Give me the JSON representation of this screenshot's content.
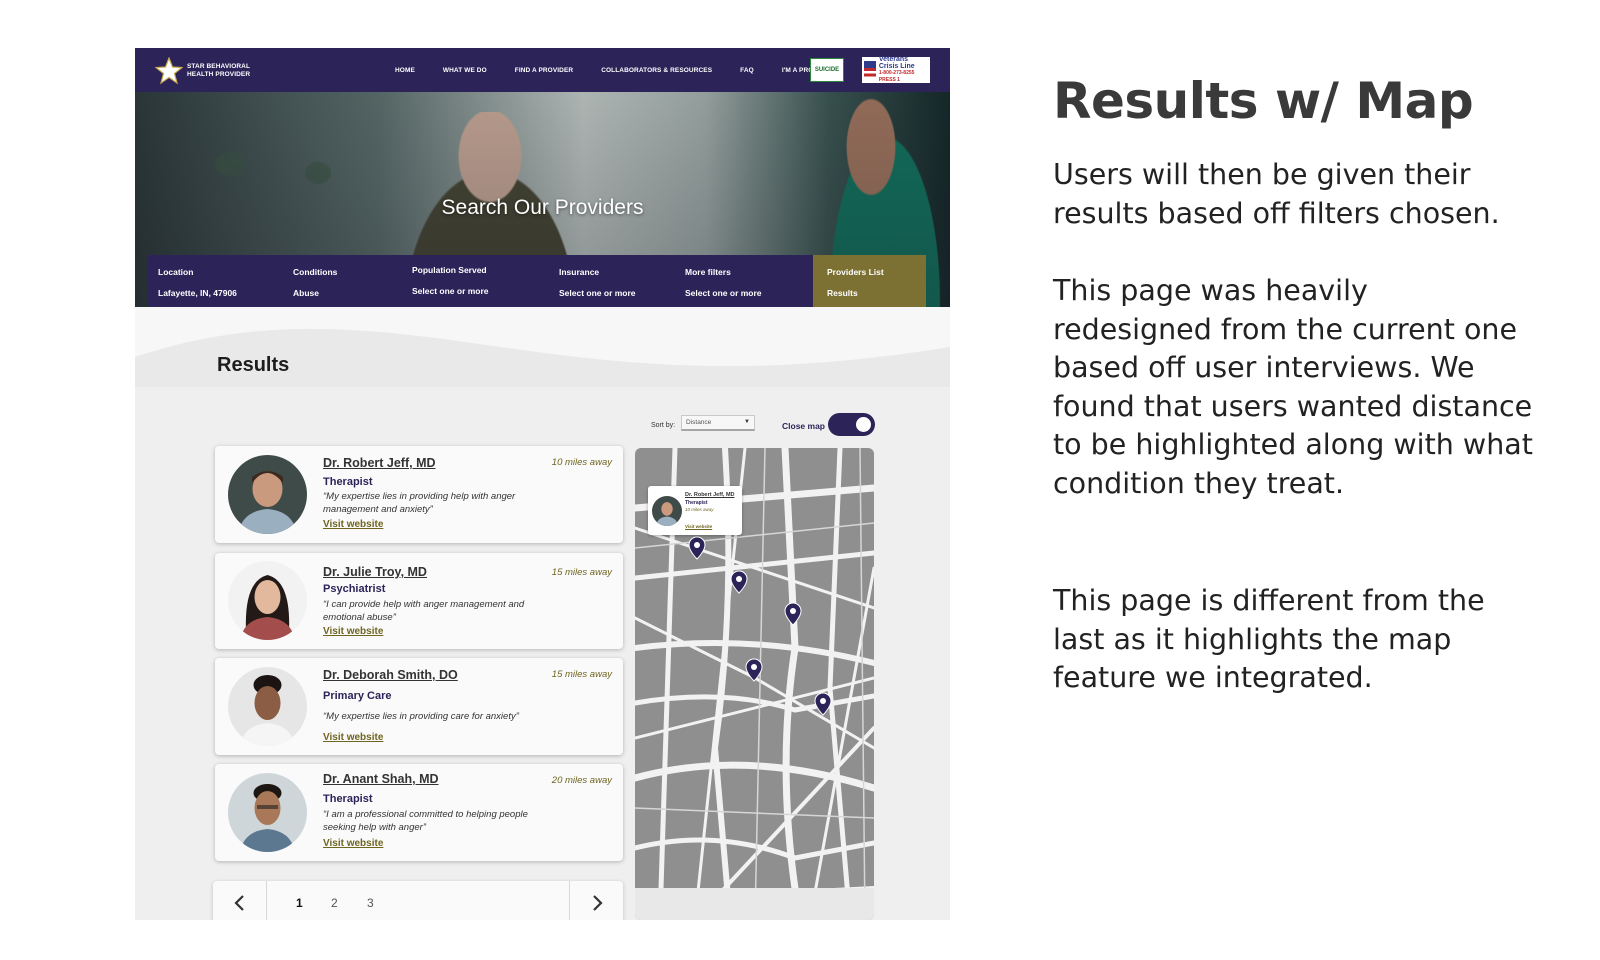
{
  "header": {
    "logo_line1": "STAR BEHAVIORAL",
    "logo_line2": "HEALTH PROVIDER",
    "nav": [
      "HOME",
      "WHAT WE DO",
      "FIND A PROVIDER",
      "COLLABORATORS & RESOURCES",
      "FAQ",
      "I'M A PROVIDER"
    ],
    "badge_suicide": "SUICIDE",
    "badge_vcl_line1": "Veterans",
    "badge_vcl_line2": "Crisis Line",
    "badge_vcl_number": "1-800-273-8255 PRESS 1"
  },
  "hero": {
    "title": "Search Our Providers"
  },
  "filters": {
    "location_label": "Location",
    "location_value": "Lafayette, IN, 47906",
    "conditions_label": "Conditions",
    "conditions_value": "Abuse",
    "population_label": "Population Served",
    "population_value": "Select one or more",
    "insurance_label": "Insurance",
    "insurance_value": "Select one or more",
    "more_label": "More filters",
    "more_value": "Select one or more",
    "providers_label": "Providers List",
    "providers_value": "Results"
  },
  "results": {
    "heading": "Results",
    "sort_label": "Sort by:",
    "sort_value": "Distance",
    "close_map_label": "Close map",
    "map_toggle_on": true
  },
  "providers": [
    {
      "name": "Dr. Robert Jeff, MD",
      "distance": "10 miles away",
      "specialty": "Therapist",
      "quote": "“My expertise lies in providing help with anger management and anxiety”",
      "website": "Visit website"
    },
    {
      "name": "Dr. Julie Troy, MD",
      "distance": "15 miles away",
      "specialty": "Psychiatrist",
      "quote": "“I can provide help with anger management and emotional abuse”",
      "website": "Visit website"
    },
    {
      "name": "Dr. Deborah Smith, DO",
      "distance": "15 miles away",
      "specialty": "Primary Care",
      "quote": "“My expertise lies in providing care for anxiety”",
      "website": "Visit website"
    },
    {
      "name": "Dr. Anant Shah, MD",
      "distance": "20 miles away",
      "specialty": "Therapist",
      "quote": "“I am a professional committed to helping people seeking help with anger”",
      "website": "Visit website"
    }
  ],
  "pagination": {
    "pages": [
      "1",
      "2",
      "3"
    ],
    "current": "1"
  },
  "map_popup": {
    "name": "Dr. Robert Jeff, MD",
    "specialty": "Therapist",
    "distance": "10 miles away",
    "website": "Visit website"
  },
  "description": {
    "title": "Results w/ Map",
    "p1": "Users will then be given their results based off filters chosen.",
    "p2": "This page was heavily redesigned from the current one based off user interviews. We found that users wanted distance to be highlighted along with what condition they treat.",
    "p3": "This page is different from the last as it highlights the map feature we integrated."
  },
  "colors": {
    "brand_purple": "#2c2459",
    "accent_olive": "#7c7032",
    "link_olive": "#6f6420",
    "map_gray": "#8f8f8f"
  },
  "icons": [
    "star-logo-icon",
    "chevron-left-icon",
    "chevron-right-icon",
    "map-pin-icon",
    "dropdown-caret-icon"
  ]
}
